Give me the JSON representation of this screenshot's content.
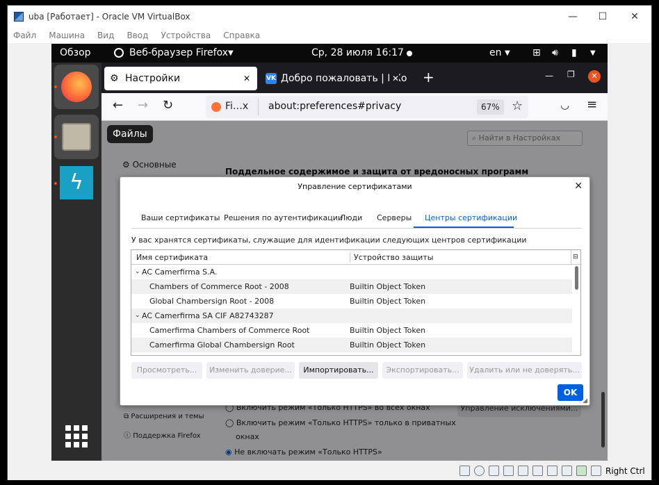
{
  "vbox": {
    "title": "uba [Работает] - Oracle VM VirtualBox",
    "menu": [
      "Файл",
      "Машина",
      "Вид",
      "Ввод",
      "Устройства",
      "Справка"
    ],
    "host_key": "Right Ctrl"
  },
  "topbar": {
    "overview": "Обзор",
    "app_menu": "Веб-браузер Firefox",
    "clock": "Ср, 28 июля  16:17",
    "lang": "en"
  },
  "dock": {
    "tooltip": "Файлы"
  },
  "firefox": {
    "tabs": [
      {
        "label": "Настройки"
      },
      {
        "label": "Добро пожаловать | ВКо"
      }
    ],
    "identity": "Fi…x",
    "url": "about:preferences#privacy",
    "zoom": "67%"
  },
  "prefs": {
    "search_placeholder": "Найти в Настройках",
    "general": "Основные",
    "section_heading": "Поддельное содержимое и защита от вредоносных программ",
    "https_all": "Включить режим «Только HTTPS» во всех окнах",
    "https_private": "Включить режим «Только HTTPS» только в приватных",
    "https_private2": "окнах",
    "https_off": "Не включать режим «Только HTTPS»",
    "manage_exceptions": "Управление исключениями...",
    "extensions": "Расширения и темы",
    "support": "Поддержка Firefox"
  },
  "dialog": {
    "title": "Управление сертификатами",
    "tabs": [
      "Ваши сертификаты",
      "Решения по аутентификации",
      "Люди",
      "Серверы",
      "Центры сертификации"
    ],
    "active_tab": 4,
    "description": "У вас хранятся сертификаты, служащие для идентификации следующих центров сертификации",
    "columns": [
      "Имя сертификата",
      "Устройство защиты"
    ],
    "rows": [
      {
        "name": "AC Camerfirma S.A.",
        "device": "",
        "group": true
      },
      {
        "name": "Chambers of Commerce Root - 2008",
        "device": "Builtin Object Token"
      },
      {
        "name": "Global Chambersign Root - 2008",
        "device": "Builtin Object Token"
      },
      {
        "name": "AC Camerfirma SA CIF A82743287",
        "device": "",
        "group": true
      },
      {
        "name": "Camerfirma Chambers of Commerce Root",
        "device": "Builtin Object Token"
      },
      {
        "name": "Camerfirma Global Chambersign Root",
        "device": "Builtin Object Token"
      }
    ],
    "buttons": {
      "view": "Просмотреть...",
      "trust": "Изменить доверие...",
      "import": "Импортировать...",
      "export": "Экспортировать...",
      "delete": "Удалить или не доверять..."
    },
    "ok": "OK"
  },
  "colors": {
    "accent": "#0060df",
    "ubuntu_orange": "#e95420"
  }
}
